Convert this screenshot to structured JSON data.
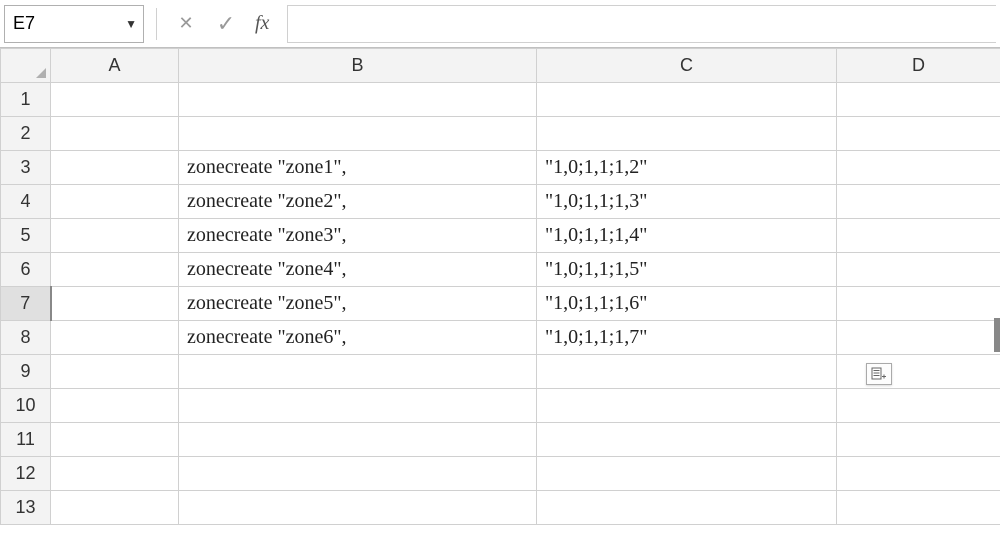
{
  "nameBox": {
    "value": "E7"
  },
  "formulaBar": {
    "fxLabel": "fx",
    "value": ""
  },
  "columns": [
    "A",
    "B",
    "C",
    "D"
  ],
  "rows": [
    {
      "n": "1",
      "A": "",
      "B": "",
      "C": "",
      "D": ""
    },
    {
      "n": "2",
      "A": "",
      "B": "",
      "C": "",
      "D": ""
    },
    {
      "n": "3",
      "A": "",
      "B": "zonecreate \"zone1\",",
      "C": "\"1,0;1,1;1,2\"",
      "D": ""
    },
    {
      "n": "4",
      "A": "",
      "B": "zonecreate \"zone2\",",
      "C": "\"1,0;1,1;1,3\"",
      "D": ""
    },
    {
      "n": "5",
      "A": "",
      "B": "zonecreate \"zone3\",",
      "C": "\"1,0;1,1;1,4\"",
      "D": ""
    },
    {
      "n": "6",
      "A": "",
      "B": "zonecreate \"zone4\",",
      "C": "\"1,0;1,1;1,5\"",
      "D": ""
    },
    {
      "n": "7",
      "A": "",
      "B": "zonecreate \"zone5\",",
      "C": "\"1,0;1,1;1,6\"",
      "D": ""
    },
    {
      "n": "8",
      "A": "",
      "B": "zonecreate \"zone6\",",
      "C": "\"1,0;1,1;1,7\"",
      "D": ""
    },
    {
      "n": "9",
      "A": "",
      "B": "",
      "C": "",
      "D": ""
    },
    {
      "n": "10",
      "A": "",
      "B": "",
      "C": "",
      "D": ""
    },
    {
      "n": "11",
      "A": "",
      "B": "",
      "C": "",
      "D": ""
    },
    {
      "n": "12",
      "A": "",
      "B": "",
      "C": "",
      "D": ""
    },
    {
      "n": "13",
      "A": "",
      "B": "",
      "C": "",
      "D": ""
    }
  ],
  "activeRow": "7"
}
